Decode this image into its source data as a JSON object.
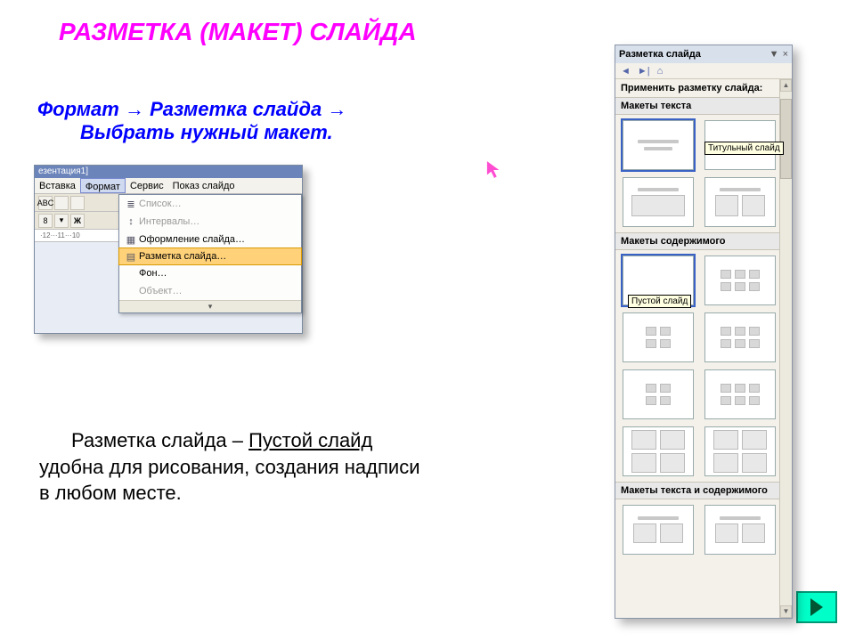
{
  "title": "РАЗМЕТКА (МАКЕТ) СЛАЙДА",
  "path": {
    "line1_a": "Формат",
    "arrow": "→",
    "line1_b": "Разметка слайда",
    "line2": "Выбрать нужный макет."
  },
  "body": {
    "prefix": "Разметка слайда – ",
    "underlined": "Пустой слайд",
    "rest": " удобна для рисования, создания надписи в любом месте."
  },
  "menu_shot": {
    "titlebar": "езентация1]",
    "menubar": [
      "Вставка",
      "Формат",
      "Сервис",
      "Показ слайдо"
    ],
    "active_index": 1,
    "toolbar_glyphs": [
      "ABC",
      "",
      ""
    ],
    "toolbar2_glyphs": [
      "8",
      "▾",
      "Ж"
    ],
    "ruler_text": "·12···11···10",
    "items": [
      {
        "icon": "≣",
        "label": "Список…",
        "disabled": true
      },
      {
        "icon": "↕",
        "label": "Интервалы…",
        "disabled": true
      },
      {
        "icon": "▦",
        "label": "Оформление слайда…",
        "disabled": false
      },
      {
        "icon": "▤",
        "label": "Разметка слайда…",
        "disabled": false,
        "highlight": true
      },
      {
        "icon": "",
        "label": "Фон…",
        "disabled": false
      },
      {
        "icon": "",
        "label": "Объект…",
        "disabled": true
      }
    ],
    "expand_glyph": "▾"
  },
  "task_pane": {
    "title": "Разметка слайда",
    "title_dropdown_glyph": "▼",
    "title_close_glyph": "×",
    "nav": {
      "back": "◄",
      "fwd": "►|",
      "home": "⌂"
    },
    "apply_label": "Применить разметку слайда:",
    "sections": {
      "text": "Макеты текста",
      "content": "Макеты содержимого",
      "text_content": "Макеты текста и содержимого"
    },
    "tooltip_title_slide": "Титульный слайд",
    "tooltip_empty_slide": "Пустой слайд",
    "scroll": {
      "up": "▲",
      "down": "▼"
    }
  },
  "next_button_aria": "next-slide"
}
